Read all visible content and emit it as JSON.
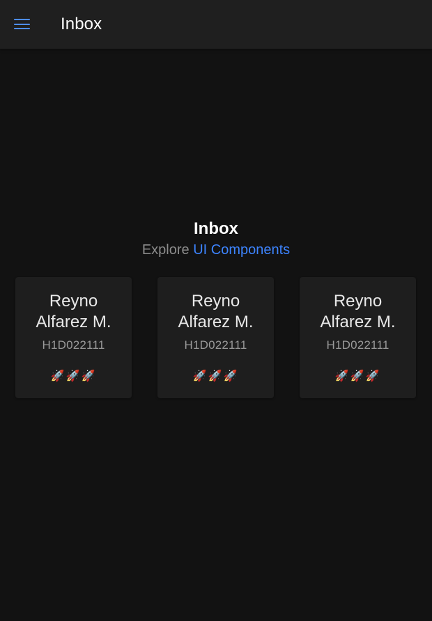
{
  "toolbar": {
    "title": "Inbox",
    "menu_icon": "menu-icon"
  },
  "main": {
    "heading": "Inbox",
    "subtitle_prefix": "Explore",
    "subtitle_link": "UI Components"
  },
  "cards": [
    {
      "name_line1": "Reyno",
      "name_line2": "Alfarez M.",
      "id": "H1D022111",
      "emoji": "🚀🚀🚀"
    },
    {
      "name_line1": "Reyno",
      "name_line2": "Alfarez M.",
      "id": "H1D022111",
      "emoji": "🚀🚀🚀"
    },
    {
      "name_line1": "Reyno",
      "name_line2": "Alfarez M.",
      "id": "H1D022111",
      "emoji": "🚀🚀🚀"
    }
  ],
  "colors": {
    "background": "#121212",
    "toolbar": "#1f1f1f",
    "card": "#1e1e1e",
    "accent": "#3d84ff"
  }
}
